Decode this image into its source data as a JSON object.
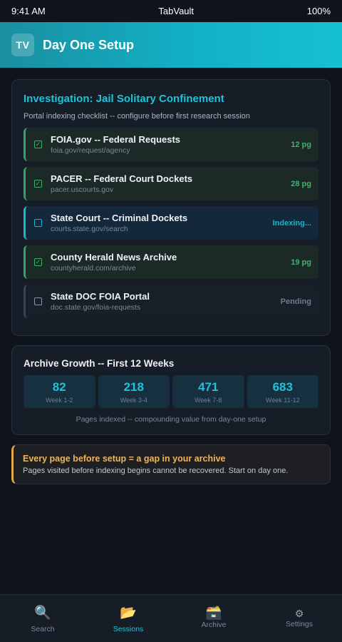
{
  "status_bar": {
    "time": "9:41 AM",
    "app_name": "TabVault",
    "battery": "100%"
  },
  "header": {
    "logo": "TV",
    "title": "Day One Setup"
  },
  "investigation": {
    "title": "Investigation: Jail Solitary Confinement",
    "subtitle": "Portal indexing checklist -- configure before first research session",
    "portals": [
      {
        "name": "FOIA.gov -- Federal Requests",
        "url": "foia.gov/request/agency",
        "status": "12 pg",
        "checked": true,
        "state": "done"
      },
      {
        "name": "PACER -- Federal Court Dockets",
        "url": "pacer.uscourts.gov",
        "status": "28 pg",
        "checked": true,
        "state": "done"
      },
      {
        "name": "State Court -- Criminal Dockets",
        "url": "courts.state.gov/search",
        "status": "Indexing...",
        "checked": false,
        "state": "indexing"
      },
      {
        "name": "County Herald News Archive",
        "url": "countyherald.com/archive",
        "status": "19 pg",
        "checked": true,
        "state": "done"
      },
      {
        "name": "State DOC FOIA Portal",
        "url": "doc.state.gov/foia-requests",
        "status": "Pending",
        "checked": false,
        "state": "pending"
      }
    ]
  },
  "growth": {
    "title": "Archive Growth -- First 12 Weeks",
    "weeks": [
      {
        "value": "82",
        "label": "Week 1-2"
      },
      {
        "value": "218",
        "label": "Week 3-4"
      },
      {
        "value": "471",
        "label": "Week 7-8"
      },
      {
        "value": "683",
        "label": "Week 11-12"
      }
    ],
    "caption": "Pages indexed -- compounding value from day-one setup"
  },
  "callout": {
    "title": "Every page before setup = a gap in your archive",
    "text": "Pages visited before indexing begins cannot be recovered. Start on day one."
  },
  "nav": {
    "items": [
      {
        "label": "Search",
        "icon": "search-icon",
        "active": false
      },
      {
        "label": "Sessions",
        "icon": "folder-icon",
        "active": true
      },
      {
        "label": "Archive",
        "icon": "archive-box-icon",
        "active": false
      },
      {
        "label": "Settings",
        "icon": "gear-icon",
        "active": false
      }
    ]
  },
  "colors": {
    "accent": "#1fc3d8",
    "success": "#3fb36c",
    "warning": "#f0b45a"
  }
}
